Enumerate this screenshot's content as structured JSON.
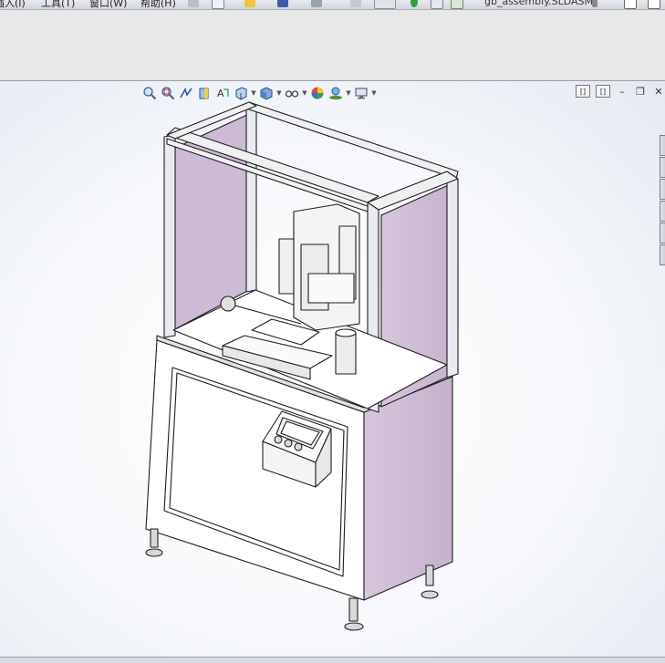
{
  "menubar": {
    "items": [
      {
        "label": "插入(I)"
      },
      {
        "label": "工具(T)"
      },
      {
        "label": "窗口(W)"
      },
      {
        "label": "帮助(H)"
      }
    ],
    "document_title": "gb_assembly.SLDASM"
  },
  "headsup_toolbar": {
    "tools": [
      {
        "name": "zoom-to-fit",
        "icon": "magnifier-icon"
      },
      {
        "name": "zoom-to-area",
        "icon": "magnifier-area-icon"
      },
      {
        "name": "previous-view",
        "icon": "previous-view-icon"
      },
      {
        "name": "section-view",
        "icon": "section-view-icon"
      },
      {
        "name": "dynamic-annotation-views",
        "icon": "annotation-view-icon"
      },
      {
        "name": "view-orientation",
        "icon": "view-orientation-icon",
        "dropdown": true
      },
      {
        "name": "display-style",
        "icon": "display-style-cube-icon",
        "dropdown": true
      },
      {
        "name": "hide-show-items",
        "icon": "glasses-icon",
        "dropdown": true
      },
      {
        "name": "edit-appearance",
        "icon": "appearance-sphere-icon"
      },
      {
        "name": "apply-scene",
        "icon": "scene-icon",
        "dropdown": true
      },
      {
        "name": "view-settings",
        "icon": "monitor-icon",
        "dropdown": true
      }
    ]
  },
  "window_controls": {
    "tile_left_label": "[]",
    "tile_right_label": "[]"
  },
  "colors": {
    "panel_fill": "#cdbad4",
    "frame_light": "#e9ebee",
    "frame_dark": "#2a2a2a",
    "viewport_bg": "#f6f8fb"
  }
}
